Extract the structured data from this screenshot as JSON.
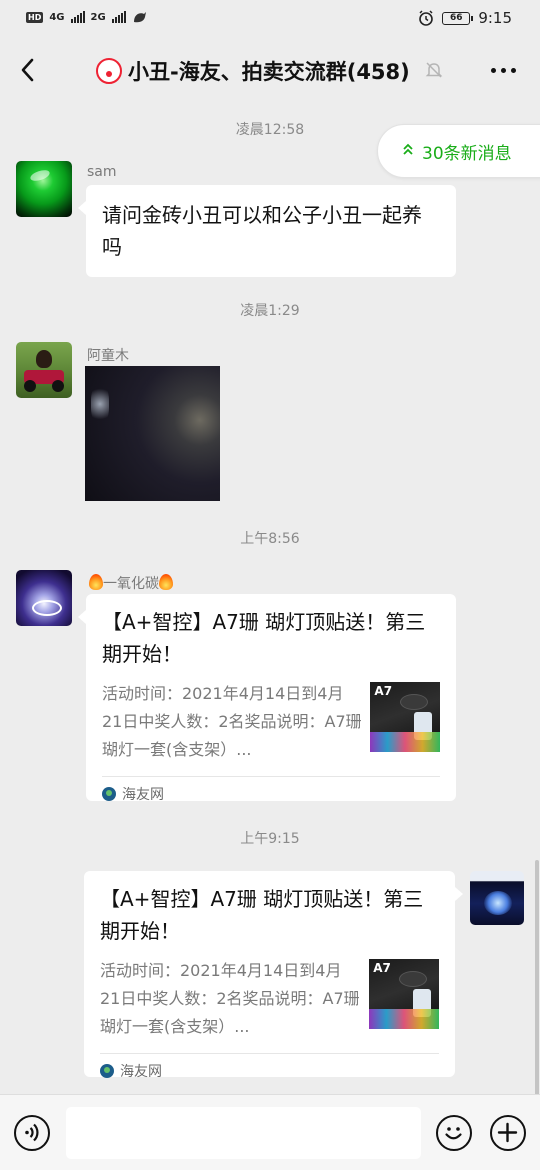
{
  "status_bar": {
    "hd": "HD",
    "net1": "4G",
    "net2": "2G",
    "battery": "66",
    "time": "9:15"
  },
  "header": {
    "title": "小丑-海友、拍卖交流群(458)"
  },
  "new_messages": {
    "label": "30条新消息"
  },
  "messages": [
    {
      "type": "timestamp",
      "text": "凌晨12:58"
    },
    {
      "type": "text",
      "sender": "sam",
      "text": "请问金砖小丑可以和公子小丑一起养吗"
    },
    {
      "type": "timestamp",
      "text": "凌晨1:29"
    },
    {
      "type": "image",
      "sender": "阿童木"
    },
    {
      "type": "timestamp",
      "text": "上午8:56"
    },
    {
      "type": "link",
      "sender": "一氧化碳",
      "title": "【A+智控】A7珊 瑚灯顶贴送！第三期开始！",
      "desc": "活动时间：2021年4月14日到4月21日中奖人数：2名奖品说明：A7珊瑚灯一套(含支架）...",
      "thumb_label": "A7",
      "source": "海友网"
    },
    {
      "type": "timestamp",
      "text": "上午9:15"
    },
    {
      "type": "link",
      "sender": "",
      "title": "【A+智控】A7珊 瑚灯顶贴送！第三期开始！",
      "desc": "活动时间：2021年4月14日到4月21日中奖人数：2名奖品说明：A7珊瑚灯一套(含支架）...",
      "thumb_label": "A7",
      "source": "海友网"
    }
  ],
  "input_bar": {
    "value": "",
    "placeholder": ""
  },
  "colors": {
    "accent_green": "#1aad19",
    "background": "#ededed",
    "bubble": "#ffffff"
  },
  "icons": [
    "back-arrow-icon",
    "mute-bell-icon",
    "more-dots-icon",
    "double-chevron-up-icon",
    "voice-icon",
    "emoji-icon",
    "plus-icon",
    "flame-icon",
    "source-logo-icon"
  ]
}
